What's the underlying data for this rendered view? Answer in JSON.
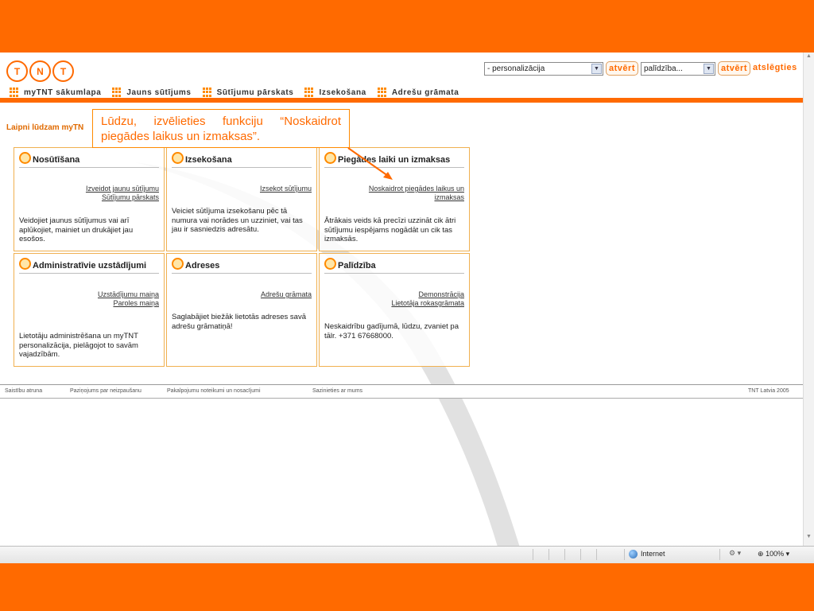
{
  "colors": {
    "brand_orange": "#ff6a00",
    "panel_border": "#f0b050"
  },
  "logo": {
    "letters": [
      "T",
      "N",
      "T"
    ]
  },
  "header": {
    "personalization_select": "- personalizācija",
    "open_button_1": "atvērt",
    "help_select": "palīdzība...",
    "open_button_2": "atvērt",
    "logout_link": "atslēgties"
  },
  "nav": {
    "items": [
      {
        "label": "myTNT sākumlapa"
      },
      {
        "label": "Jauns sūtījums"
      },
      {
        "label": "Sūtījumu pārskats"
      },
      {
        "label": "Izsekošana"
      },
      {
        "label": "Adrešu grāmata"
      }
    ]
  },
  "welcome": "Laipni lūdzam myTN",
  "callout": "Lūdzu, izvēlieties funkciju “Noskaidrot piegādes laikus un izmaksas”.",
  "panels": [
    {
      "title": "Nosūtīšana",
      "icon": "truck-icon",
      "links": [
        "Izveidot jaunu sūtījumu",
        "Sūtījumu pārskats"
      ],
      "description": "Veidojiet jaunus sūtījumus vai arī aplūkojiet, mainiet un drukājiet jau esošos."
    },
    {
      "title": "Izsekošana",
      "icon": "magnifier-icon",
      "links": [
        "Izsekot sūtījumu"
      ],
      "description": "Veiciet sūtījuma izsekošanu pēc tā numura vai norādes un uzziniet, vai tas jau ir sasniedzis adresātu."
    },
    {
      "title": "Piegādes laiki un izmaksas",
      "icon": "clock-icon",
      "links": [
        "Noskaidrot piegādes laikus un izmaksas"
      ],
      "description": "Ātrākais veids kā precīzi uzzināt cik ātri sūtījumu iespējams nogādāt un cik tas izmaksās."
    },
    {
      "title": "Administratīvie uzstādījumi",
      "icon": "settings-icon",
      "links": [
        "Uzstādījumu maiņa",
        "Paroles maiņa"
      ],
      "description": "Lietotāju administrēšana un myTNT personalizācija, pielāgojot to savām vajadzībām."
    },
    {
      "title": "Adreses",
      "icon": "address-book-icon",
      "links": [
        "Adrešu grāmata"
      ],
      "description": "Saglabājiet biežāk lietotās adreses savā adrešu grāmatiņā!"
    },
    {
      "title": "Palīdzība",
      "icon": "help-icon",
      "links": [
        "Demonstrācija",
        "Lietotāja rokasgrāmata"
      ],
      "description": "Neskaidrību gadījumā, lūdzu, zvaniet pa tālr. +371 67668000."
    }
  ],
  "footer": {
    "links": [
      "Saistību atruna",
      "Paziņojums par neizpaušanu",
      "Pakalpojumu noteikumi un nosacījumi",
      "Sazinieties ar mums"
    ],
    "copyright": "TNT Latvia 2005"
  },
  "statusbar": {
    "zone": "Internet",
    "zoom": "100%"
  }
}
